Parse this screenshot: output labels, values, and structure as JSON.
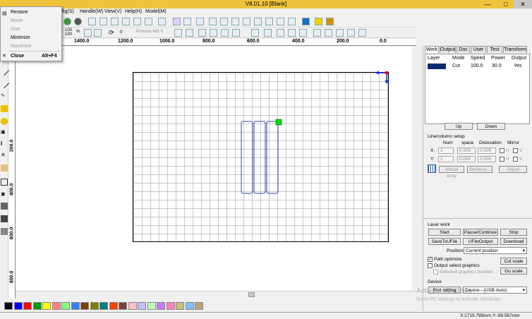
{
  "window": {
    "title": "V8.01.10 [Blank]"
  },
  "menubar": {
    "items": [
      "Config(S)",
      "Handle(W)",
      "View(V)",
      "Help(H)",
      "Model(M)"
    ],
    "partial_first": "fig(S)"
  },
  "context_menu": {
    "items": [
      {
        "label": "Restore",
        "enabled": true,
        "shortcut": ""
      },
      {
        "label": "Move",
        "enabled": false,
        "shortcut": ""
      },
      {
        "label": "Size",
        "enabled": false,
        "shortcut": ""
      },
      {
        "label": "Minimize",
        "enabled": true,
        "shortcut": ""
      },
      {
        "label": "Maximize",
        "enabled": false,
        "shortcut": ""
      },
      {
        "label": "Close",
        "enabled": true,
        "shortcut": "Alt+F4"
      }
    ]
  },
  "toolbar2": {
    "size_a": "100",
    "size_b": "100",
    "percent": "%",
    "angle": "0",
    "process_label": "Process NO:",
    "process_value": "0"
  },
  "ruler": {
    "top_labels": [
      "1400.0",
      "1200.0",
      "1000.0",
      "800.0",
      "600.0",
      "400.0",
      "200.0",
      "0.0"
    ],
    "left_labels": [
      "200.0",
      "400.0",
      "600.0",
      "800.0"
    ]
  },
  "panel": {
    "tabs": [
      "Work",
      "Output",
      "Doc",
      "User",
      "Test",
      "Transform"
    ],
    "active_tab": "Work",
    "layer_headers": [
      "Layer",
      "Mode",
      "Speed",
      "Power",
      "Output"
    ],
    "layers": [
      {
        "color": "#0a2a6e",
        "mode": "Cut",
        "speed": "100.0",
        "power": "30.0",
        "output": "Yes"
      }
    ],
    "up_label": "Up",
    "down_label": "Down",
    "line_column_title": "Line/column setup",
    "grid_headers": [
      "Num",
      "space",
      "Dislocation",
      "Mirror"
    ],
    "x_label": "X:",
    "y_label": "Y:",
    "x_num": "1",
    "x_space": "0.000",
    "x_disloc": "0.000",
    "y_num": "1",
    "y_space": "0.000",
    "y_disloc": "0.000",
    "mirror_h": "H",
    "mirror_v": "V",
    "virtual_array": "Virtual array",
    "bestrew": "Bestrew...",
    "adjust": "Adjust",
    "laser_work_title": "Laser work",
    "start": "Start",
    "pause": "Pause/Continue",
    "stop": "Stop",
    "save_to_file": "SaveToUFile",
    "ufile_output": "UFileOutput",
    "download": "Download",
    "position_label": "Position:",
    "position_value": "Current position",
    "path_optimize": "Path optimize",
    "path_optimize_checked": true,
    "output_select": "Output select graphics",
    "output_select_checked": false,
    "selected_pos": "Selected graphics position",
    "cut_scale": "Cut scale",
    "go_scale": "Go scale",
    "device_title": "Device",
    "port_setting": "Port setting",
    "device_value": "Device---(USB:Auto)"
  },
  "watermark": {
    "line1": "Activate Windows",
    "line2": "Go to PC settings to activate Windows."
  },
  "status": {
    "coords": "X:1719.789mm,Y:-99.567mm"
  },
  "palette": {
    "colors": [
      "#000000",
      "#0000ff",
      "#ff0000",
      "#00a000",
      "#ffff00",
      "#ff8080",
      "#80ff80",
      "#3080ff",
      "#804000",
      "#808000",
      "#008080",
      "#ff4000",
      "#804040",
      "#ffc0cb",
      "#c0c0ff",
      "#c0ffc0",
      "#c080ff",
      "#ff80c0",
      "#c0c080",
      "#80c0ff",
      "#c0a080"
    ]
  },
  "colors": {
    "title_bar": "#f0c33c",
    "layer_blue": "#0a2a6e",
    "shape_stroke": "#3a4a9e",
    "handle_green": "#00e000"
  }
}
